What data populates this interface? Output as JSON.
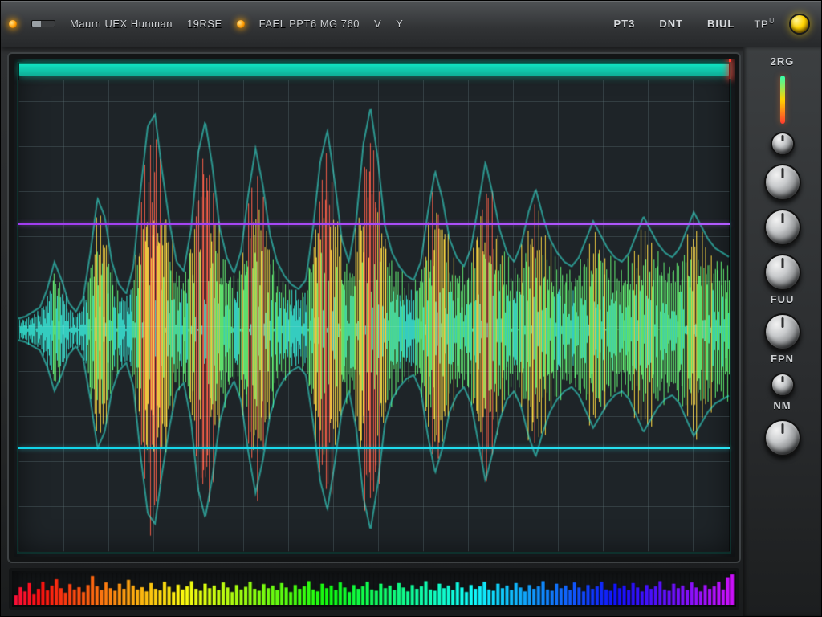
{
  "toolbar": {
    "items": [
      {
        "type": "led",
        "name": "power-led"
      },
      {
        "type": "bar",
        "name": "level-mini-meter"
      },
      {
        "type": "label",
        "name": "label-mode",
        "text": "Maurn UEX Hunman"
      },
      {
        "type": "label",
        "name": "label-sec",
        "text": "19RSE"
      },
      {
        "type": "led",
        "name": "rec-led"
      },
      {
        "type": "label",
        "name": "label-rate",
        "text": "FAEL PPT6 MG 760"
      },
      {
        "type": "label",
        "name": "label-v",
        "text": "V"
      },
      {
        "type": "label",
        "name": "label-y",
        "text": "Y"
      },
      {
        "type": "spacer"
      },
      {
        "type": "button",
        "name": "btn-pt3",
        "text": "PT3"
      },
      {
        "type": "button",
        "name": "btn-dnt",
        "text": "DNT"
      },
      {
        "type": "button",
        "name": "btn-biul",
        "text": "BIUL"
      },
      {
        "type": "label",
        "name": "label-tpu",
        "text": "TP",
        "sup": "U"
      },
      {
        "type": "knob",
        "name": "knob-master"
      }
    ]
  },
  "side": {
    "channel_label": "2RG",
    "knobs": [
      {
        "name": "knob-gain",
        "size": "small"
      },
      {
        "name": "knob-freq",
        "size": "large"
      },
      {
        "name": "knob-q",
        "size": "large"
      },
      {
        "name": "knob-fuu",
        "size": "large",
        "label": "FUU"
      },
      {
        "name": "knob-fpn",
        "size": "large",
        "label": "FPN"
      },
      {
        "name": "knob-nm",
        "size": "small",
        "label": "NM"
      },
      {
        "name": "knob-aux",
        "size": "large"
      }
    ]
  },
  "screen": {
    "progress": 1.0,
    "markers": [
      {
        "name": "marker-hi",
        "pos": 0.33,
        "color": "purple"
      },
      {
        "name": "marker-lo",
        "pos": 0.78,
        "color": "cyan"
      }
    ],
    "grid": {
      "cols": 16,
      "rows": 10
    }
  },
  "chart_data": {
    "type": "area",
    "title": "",
    "xlabel": "",
    "ylabel": "",
    "xlim": [
      0,
      1
    ],
    "ylim": [
      -1,
      1
    ],
    "series": [
      {
        "name": "waveform-envelope",
        "x_step": 0.01,
        "values": [
          0.05,
          0.06,
          0.08,
          0.1,
          0.18,
          0.3,
          0.22,
          0.12,
          0.08,
          0.14,
          0.34,
          0.58,
          0.5,
          0.3,
          0.2,
          0.16,
          0.28,
          0.62,
          0.9,
          0.95,
          0.7,
          0.48,
          0.3,
          0.26,
          0.44,
          0.78,
          0.92,
          0.72,
          0.45,
          0.32,
          0.25,
          0.35,
          0.6,
          0.8,
          0.64,
          0.42,
          0.3,
          0.24,
          0.2,
          0.18,
          0.22,
          0.45,
          0.74,
          0.88,
          0.66,
          0.4,
          0.3,
          0.48,
          0.82,
          0.98,
          0.76,
          0.46,
          0.34,
          0.28,
          0.24,
          0.22,
          0.3,
          0.52,
          0.7,
          0.58,
          0.4,
          0.32,
          0.28,
          0.36,
          0.55,
          0.74,
          0.6,
          0.44,
          0.34,
          0.3,
          0.38,
          0.52,
          0.62,
          0.5,
          0.4,
          0.34,
          0.3,
          0.28,
          0.32,
          0.4,
          0.48,
          0.42,
          0.36,
          0.32,
          0.3,
          0.34,
          0.42,
          0.5,
          0.44,
          0.38,
          0.34,
          0.32,
          0.36,
          0.44,
          0.52,
          0.46,
          0.4,
          0.36,
          0.34,
          0.32
        ]
      },
      {
        "name": "spectrum-bars",
        "x_step": 0.00625,
        "values": [
          0.3,
          0.55,
          0.42,
          0.68,
          0.35,
          0.5,
          0.72,
          0.45,
          0.6,
          0.8,
          0.52,
          0.38,
          0.65,
          0.48,
          0.55,
          0.4,
          0.62,
          0.9,
          0.58,
          0.46,
          0.7,
          0.52,
          0.44,
          0.66,
          0.5,
          0.78,
          0.6,
          0.48,
          0.55,
          0.42,
          0.68,
          0.5,
          0.45,
          0.72,
          0.56,
          0.4,
          0.63,
          0.48,
          0.58,
          0.74,
          0.5,
          0.44,
          0.66,
          0.52,
          0.6,
          0.46,
          0.7,
          0.54,
          0.4,
          0.62,
          0.48,
          0.56,
          0.72,
          0.5,
          0.44,
          0.65,
          0.52,
          0.6,
          0.46,
          0.68,
          0.54,
          0.4,
          0.62,
          0.5,
          0.58,
          0.74,
          0.48,
          0.42,
          0.66,
          0.52,
          0.6,
          0.46,
          0.7,
          0.54,
          0.4,
          0.62,
          0.5,
          0.58,
          0.72,
          0.48,
          0.44,
          0.66,
          0.52,
          0.6,
          0.46,
          0.68,
          0.54,
          0.42,
          0.62,
          0.5,
          0.58,
          0.74,
          0.48,
          0.44,
          0.66,
          0.52,
          0.6,
          0.46,
          0.7,
          0.54,
          0.4,
          0.62,
          0.5,
          0.58,
          0.72,
          0.48,
          0.44,
          0.66,
          0.52,
          0.6,
          0.46,
          0.68,
          0.54,
          0.42,
          0.62,
          0.5,
          0.58,
          0.74,
          0.48,
          0.44,
          0.66,
          0.52,
          0.6,
          0.46,
          0.7,
          0.54,
          0.42,
          0.62,
          0.5,
          0.58,
          0.72,
          0.48,
          0.44,
          0.66,
          0.52,
          0.6,
          0.46,
          0.68,
          0.54,
          0.42,
          0.62,
          0.5,
          0.58,
          0.74,
          0.48,
          0.44,
          0.66,
          0.52,
          0.6,
          0.46,
          0.7,
          0.54,
          0.42,
          0.62,
          0.5,
          0.58,
          0.72,
          0.48,
          0.86,
          0.95
        ]
      }
    ]
  }
}
